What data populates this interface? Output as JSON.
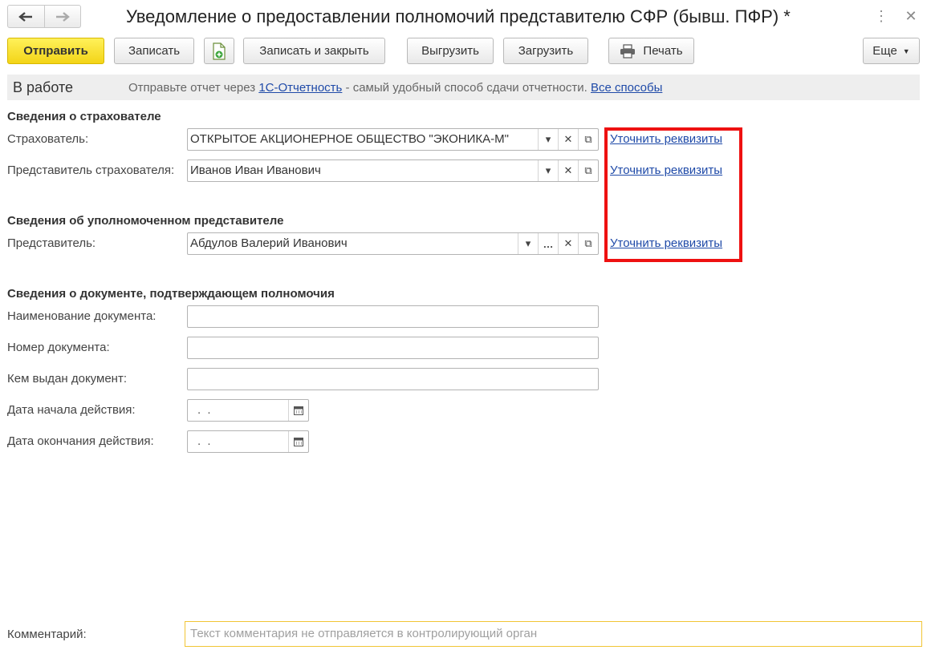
{
  "window": {
    "title": "Уведомление о предоставлении полномочий представителю СФР (бывш. ПФР) *",
    "menu_icon": "more-vertical-icon",
    "close_icon": "close-icon"
  },
  "toolbar": {
    "send": "Отправить",
    "save": "Записать",
    "save_close": "Записать и закрыть",
    "export": "Выгрузить",
    "import": "Загрузить",
    "print": "Печать",
    "more": "Еще"
  },
  "status": {
    "title": "В работе",
    "text_prefix": "Отправьте отчет через",
    "link_1c": "1С-Отчетность",
    "text_middle": "- самый удобный способ сдачи отчетности.",
    "link_all": "Все способы"
  },
  "insurer": {
    "heading": "Сведения о страхователе",
    "insurer_label": "Страхователь:",
    "insurer_value": "ОТКРЫТОЕ АКЦИОНЕРНОЕ ОБЩЕСТВО \"ЭКОНИКА-М\"",
    "rep_label": "Представитель страхователя:",
    "rep_value": "Иванов Иван Иванович"
  },
  "authorized": {
    "heading": "Сведения об уполномоченном представителе",
    "rep_label": "Представитель:",
    "rep_value": "Абдулов Валерий Иванович"
  },
  "links": {
    "clarify": "Уточнить реквизиты"
  },
  "document": {
    "heading": "Сведения о документе, подтверждающем полномочия",
    "name_label": "Наименование документа:",
    "name_value": "",
    "number_label": "Номер документа:",
    "number_value": "",
    "issuer_label": "Кем выдан документ:",
    "issuer_value": "",
    "start_label": "Дата начала действия:",
    "start_value": " .  .",
    "end_label": "Дата окончания действия:",
    "end_value": " .  ."
  },
  "comment": {
    "label": "Комментарий:",
    "placeholder": "Текст комментария не отправляется в контролирующий орган"
  },
  "colors": {
    "primary_button": "#f5d81e",
    "link": "#1f4aa8",
    "highlight_box": "#ee1111",
    "comment_border": "#f1c534"
  }
}
